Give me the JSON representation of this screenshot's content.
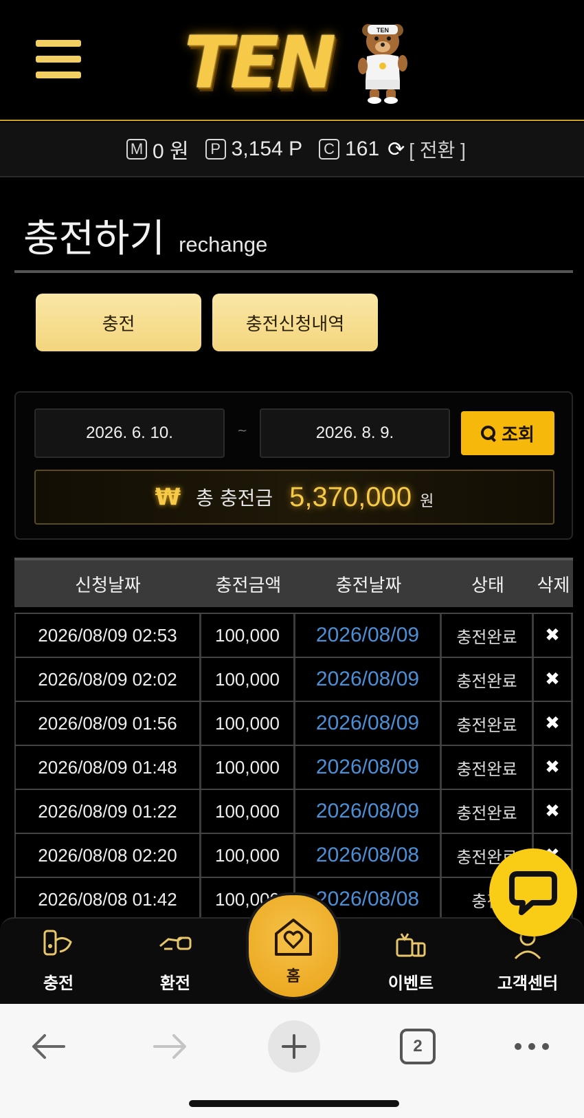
{
  "header": {
    "logo_text": "TEN",
    "bear_badge": "TEN"
  },
  "balance": {
    "money_badge": "M",
    "money": "0 원",
    "point_badge": "P",
    "point": "3,154 P",
    "coin_badge": "C",
    "coin": "161",
    "switch_label": "[ 전환 ]"
  },
  "title": {
    "ko": "충전하기",
    "en": "rechange"
  },
  "tabs": {
    "charge": "충전",
    "history": "충전신청내역"
  },
  "filter": {
    "start_date": "2026. 6. 10.",
    "separator": "~",
    "end_date": "2026. 8. 9.",
    "search_label": "조회",
    "total_symbol": "₩",
    "total_label": "총 충전금",
    "total_amount": "5,370,000",
    "total_unit": "원"
  },
  "table": {
    "headers": [
      "신청날짜",
      "충전금액",
      "충전날짜",
      "상태",
      "삭제"
    ],
    "rows": [
      {
        "requested": "2026/08/09 02:53",
        "amount": "100,000",
        "charged": "2026/08/09",
        "status": "충전완료",
        "delete": "✖"
      },
      {
        "requested": "2026/08/09 02:02",
        "amount": "100,000",
        "charged": "2026/08/09",
        "status": "충전완료",
        "delete": "✖"
      },
      {
        "requested": "2026/08/09 01:56",
        "amount": "100,000",
        "charged": "2026/08/09",
        "status": "충전완료",
        "delete": "✖"
      },
      {
        "requested": "2026/08/09 01:48",
        "amount": "100,000",
        "charged": "2026/08/09",
        "status": "충전완료",
        "delete": "✖"
      },
      {
        "requested": "2026/08/09 01:22",
        "amount": "100,000",
        "charged": "2026/08/09",
        "status": "충전완료",
        "delete": "✖"
      },
      {
        "requested": "2026/08/08 02:20",
        "amount": "100,000",
        "charged": "2026/08/08",
        "status": "충전완료",
        "delete": "✖"
      },
      {
        "requested": "2026/08/08 01:42",
        "amount": "100,000",
        "charged": "2026/08/08",
        "status": "충전",
        "delete": ""
      }
    ]
  },
  "bottom_nav": {
    "charge": "충전",
    "exchange": "환전",
    "home": "홈",
    "event": "이벤트",
    "support": "고객센터"
  },
  "browser": {
    "tab_count": "2"
  },
  "colors": {
    "gold": "#f7c948",
    "button_gold": "#f5b80b",
    "link_blue": "#4b8fd6",
    "chat_yellow": "#f9cc16"
  },
  "icons": [
    "menu-icon",
    "refresh-icon",
    "search-icon",
    "close-icon",
    "chat-icon",
    "charge-icon",
    "exchange-icon",
    "home-icon",
    "gift-icon",
    "support-icon",
    "back-arrow-icon",
    "forward-arrow-icon",
    "plus-icon",
    "more-icon"
  ]
}
